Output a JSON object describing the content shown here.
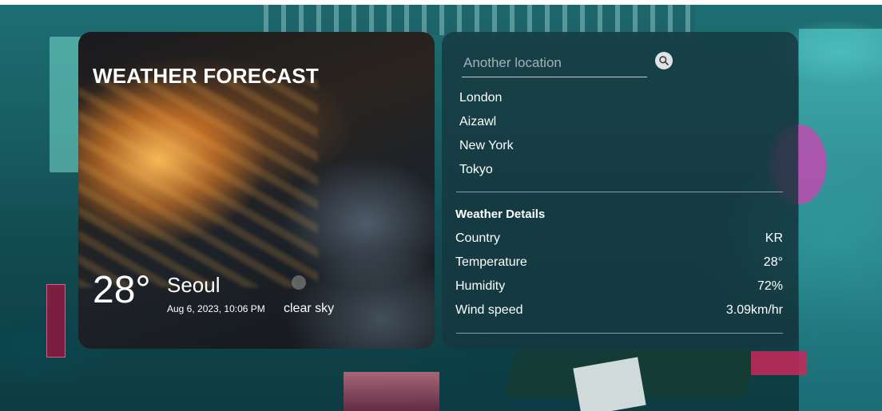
{
  "app": {
    "title": "WEATHER FORECAST"
  },
  "current": {
    "temperature": "28°",
    "city": "Seoul",
    "datetime": "Aug 6, 2023, 10:06 PM",
    "condition": "clear sky",
    "condition_icon": "moon-icon"
  },
  "search": {
    "placeholder": "Another location",
    "value": "",
    "button_icon": "search-icon"
  },
  "locations": [
    "London",
    "Aizawl",
    "New York",
    "Tokyo"
  ],
  "details": {
    "title": "Weather Details",
    "rows": [
      {
        "label": "Country",
        "value": "KR"
      },
      {
        "label": "Temperature",
        "value": "28°"
      },
      {
        "label": "Humidity",
        "value": "72%"
      },
      {
        "label": "Wind speed",
        "value": "3.09km/hr"
      }
    ]
  },
  "colors": {
    "panel_bg": "#16373e",
    "text": "#ffffff",
    "divider": "#dce1e4"
  }
}
